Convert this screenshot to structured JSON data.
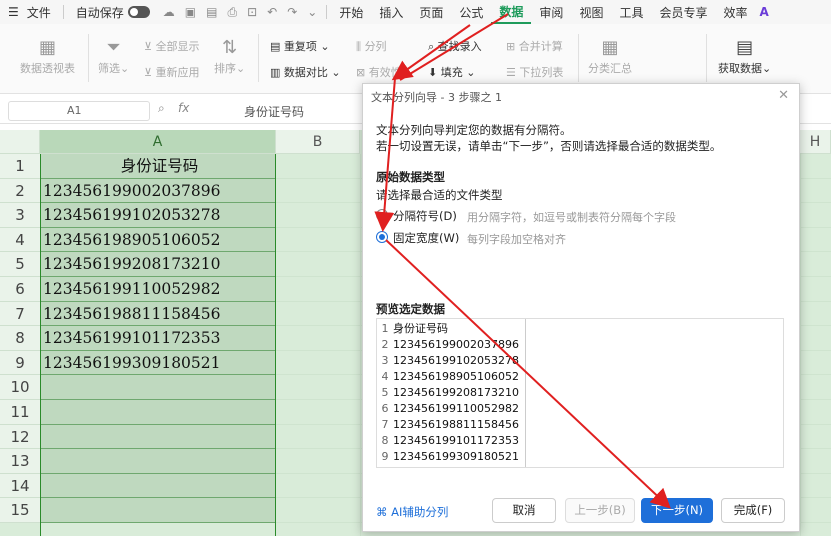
{
  "menubar": {
    "file_label": "文件",
    "autosave_label": "自动保存",
    "tabs": [
      "开始",
      "插入",
      "页面",
      "公式",
      "数据",
      "审阅",
      "视图",
      "工具",
      "会员专享",
      "效率"
    ]
  },
  "ribbon": {
    "pivot": "数据透视表",
    "filter": "筛选",
    "show_all": "全部显示",
    "reapply": "重新应用",
    "sort": "排序",
    "duplicates": "重复项",
    "compare": "数据对比",
    "split": "分列",
    "valid": "有效性",
    "lookup": "查找录入",
    "fill": "填充",
    "merge_calc": "合并计算",
    "dropdown": "下拉列表",
    "subtotal": "分类汇总",
    "get_data": "获取数据"
  },
  "formula_bar": {
    "cell_ref": "A1",
    "fx_label": "fx",
    "content": "身份证号码"
  },
  "sheet": {
    "columns": [
      "A",
      "B",
      "H"
    ],
    "row_numbers": [
      "1",
      "2",
      "3",
      "4",
      "5",
      "6",
      "7",
      "8",
      "9",
      "10",
      "11",
      "12",
      "13",
      "14",
      "15"
    ],
    "cells": [
      "身份证号码",
      "123456199002037896",
      "123456199102053278",
      "123456198905106052",
      "123456199208173210",
      "123456199110052982",
      "123456198811158456",
      "123456199101172353",
      "123456199309180521"
    ]
  },
  "dialog": {
    "title": "文本分列向导 - 3 步骤之 1",
    "intro1": "文本分列向导判定您的数据有分隔符。",
    "intro2": "若一切设置无误，请单击“下一步”，否则请选择最合适的数据类型。",
    "section": "原始数据类型",
    "choose": "请选择最合适的文件类型",
    "opt_delim": "分隔符号(D)",
    "opt_delim_desc": "用分隔字符，如逗号或制表符分隔每个字段",
    "opt_fixed": "固定宽度(W)",
    "opt_fixed_desc": "每列字段加空格对齐",
    "preview_title": "预览选定数据",
    "preview_rows": [
      "身份证号码",
      "123456199002037896",
      "123456199102053278",
      "123456198905106052",
      "123456199208173210",
      "123456199110052982",
      "123456198811158456",
      "123456199101172353",
      "123456199309180521"
    ],
    "ai_split": "AI辅助分列",
    "cancel": "取消",
    "prev": "上一步(B)",
    "next": "下一步(N)",
    "finish": "完成(F)"
  },
  "colors": {
    "accent": "#1e9b5b",
    "primary_button": "#1e6fd9",
    "arrow": "#e02020"
  }
}
